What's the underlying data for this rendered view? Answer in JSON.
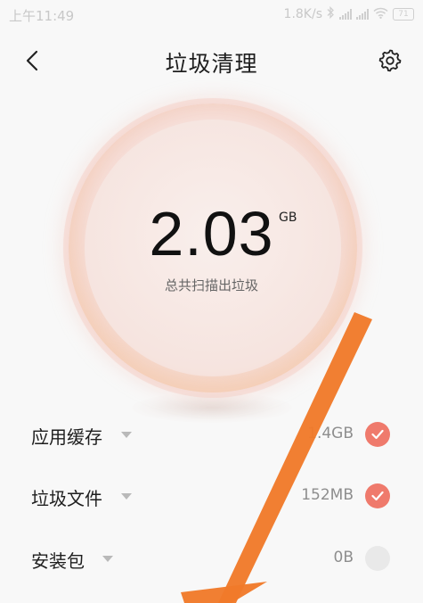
{
  "status_bar": {
    "time": "上午11:49",
    "speed": "1.8K/s",
    "battery": "71",
    "icons": [
      "bluetooth-icon",
      "signal-icon",
      "signal-icon",
      "wifi-icon",
      "battery-icon"
    ]
  },
  "header": {
    "title": "垃圾清理",
    "back_icon": "chevron-left-icon",
    "settings_icon": "gear-icon"
  },
  "scan": {
    "total_size": "2.03",
    "unit": "GB",
    "caption": "总共扫描出垃圾"
  },
  "items": [
    {
      "label": "应用缓存",
      "size": "1.4GB",
      "checked": true
    },
    {
      "label": "垃圾文件",
      "size": "152MB",
      "checked": true
    },
    {
      "label": "安装包",
      "size": "0B",
      "checked": false
    }
  ],
  "colors": {
    "accent": "#ef7a6c",
    "arrow": "#f07a2a",
    "background": "#f8f8f8"
  }
}
